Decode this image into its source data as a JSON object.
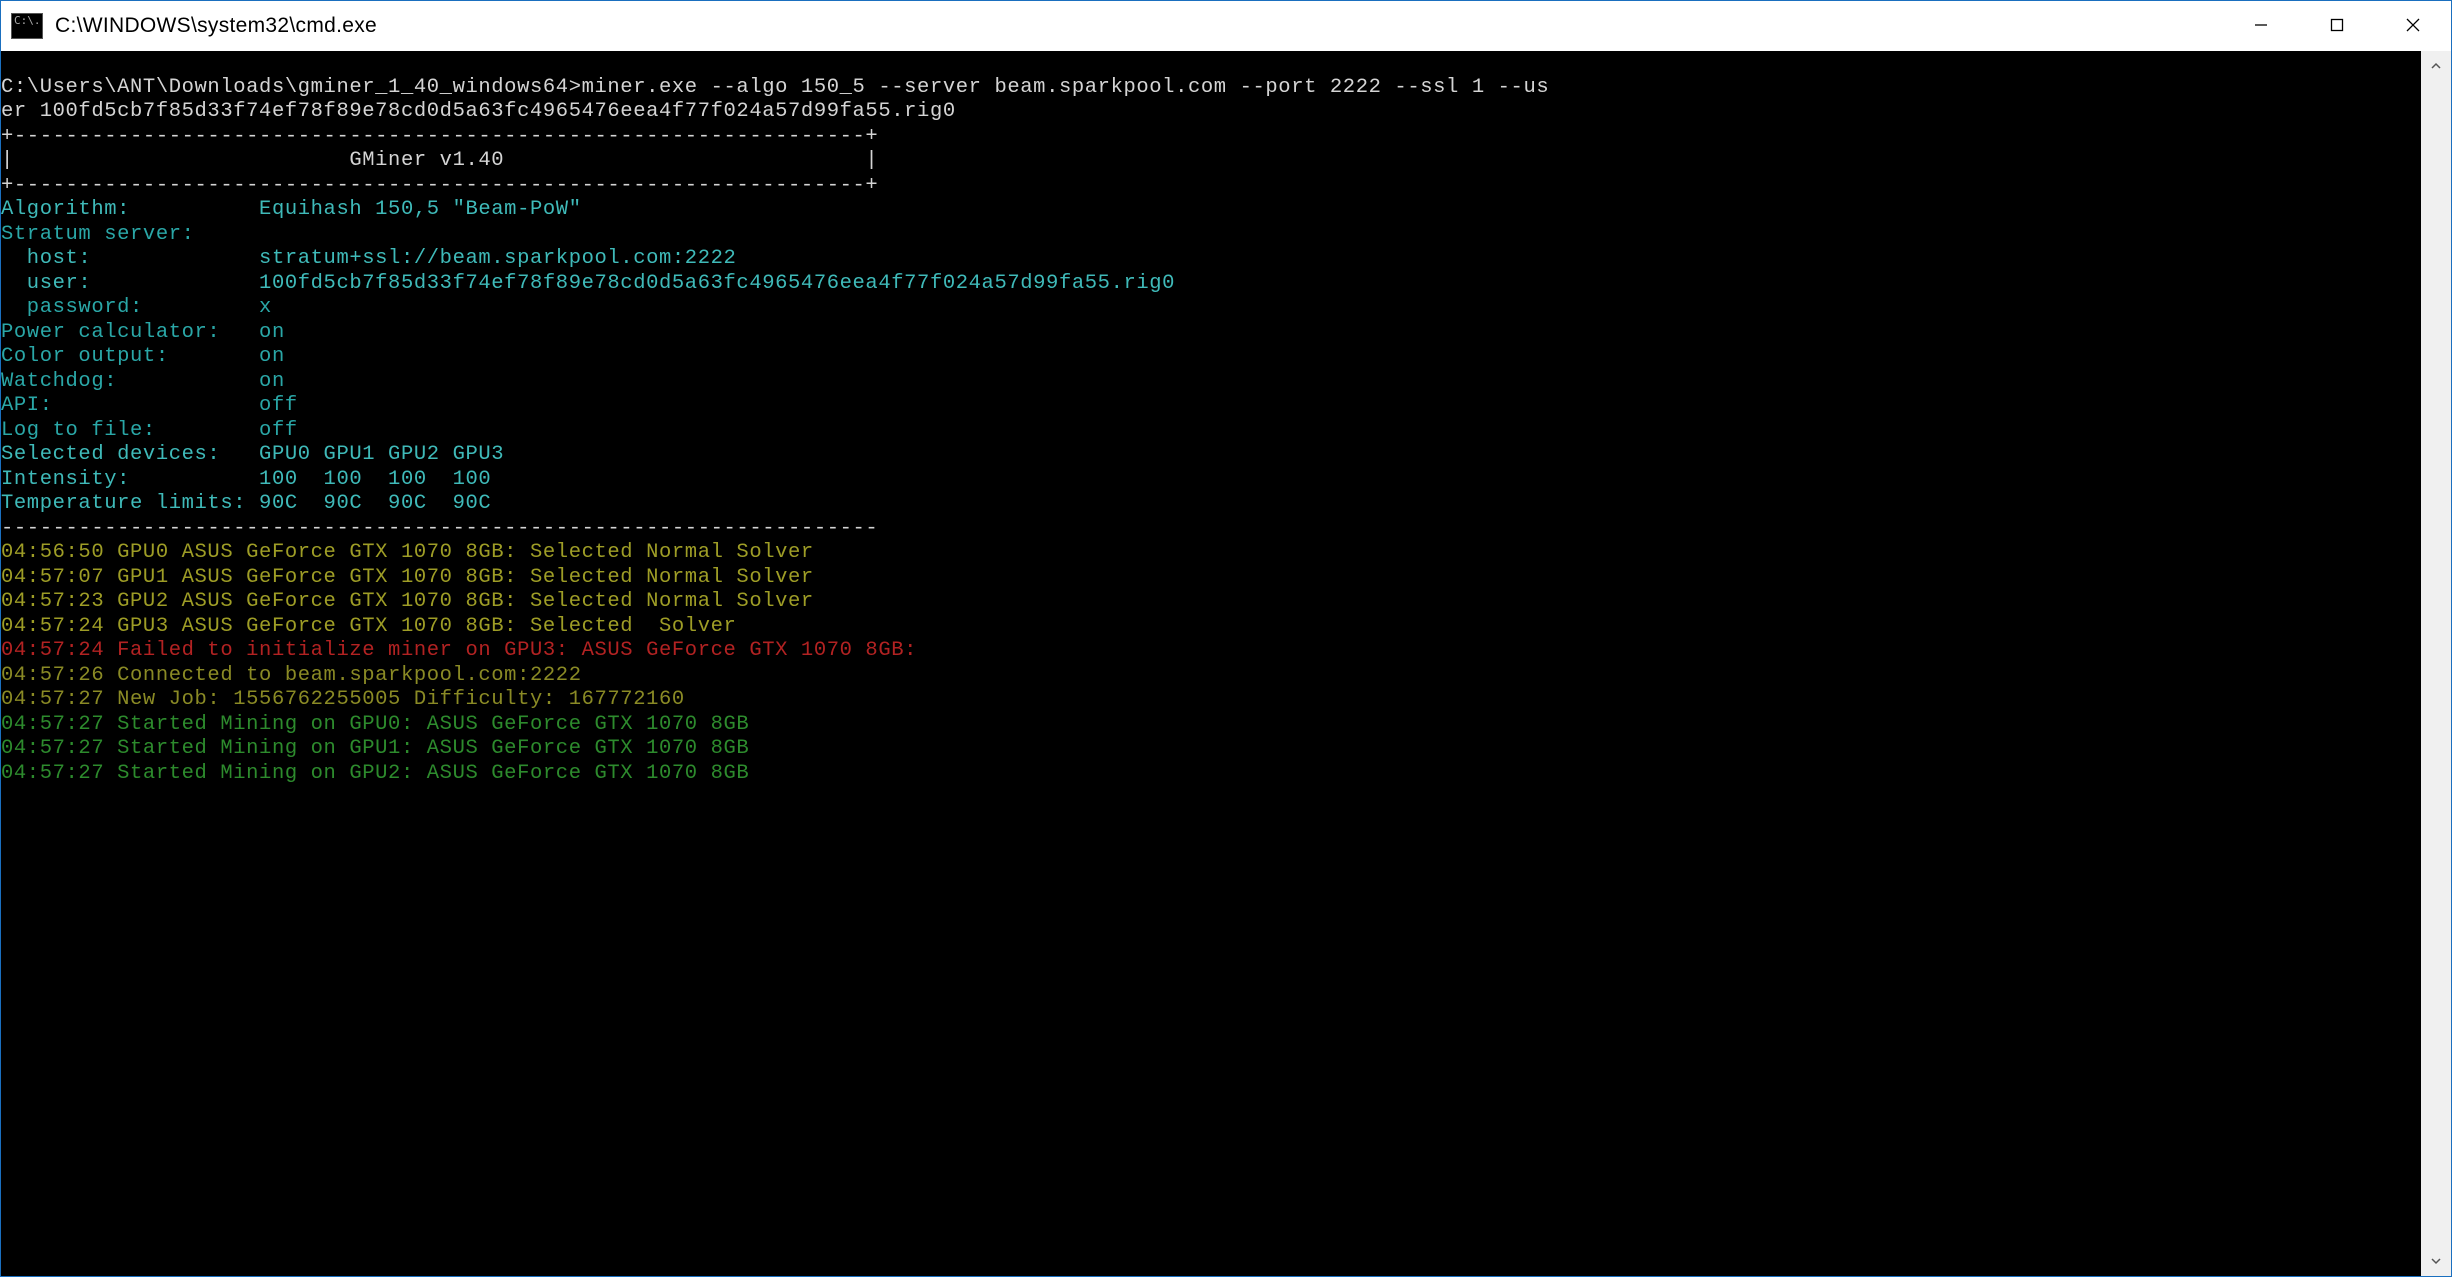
{
  "window": {
    "title": "C:\\WINDOWS\\system32\\cmd.exe",
    "icon_label": "C:\\."
  },
  "command": {
    "prompt": "C:\\Users\\ANT\\Downloads\\gminer_1_40_windows64>",
    "line1": "miner.exe --algo 150_5 --server beam.sparkpool.com --port 2222 --ssl 1 --us",
    "line2": "er 100fd5cb7f85d33f74ef78f89e78cd0d5a63fc4965476eea4f77f024a57d99fa55.rig0"
  },
  "header": {
    "border_top": "+------------------------------------------------------------------+",
    "title_row": "|                          GMiner v1.40                            |",
    "border_bot": "+------------------------------------------------------------------+"
  },
  "config": {
    "algorithm": "Algorithm:          Equihash 150,5 \"Beam-PoW\"",
    "stratum_header": "Stratum server:",
    "host": "  host:             stratum+ssl://beam.sparkpool.com:2222",
    "user": "  user:             100fd5cb7f85d33f74ef78f89e78cd0d5a63fc4965476eea4f77f024a57d99fa55.rig0",
    "password": "  password:         x",
    "power_calc": "Power calculator:   on",
    "color_output": "Color output:       on",
    "watchdog": "Watchdog:           on",
    "api": "API:                off",
    "log_to_file": "Log to file:        off",
    "selected_devices": "Selected devices:   GPU0 GPU1 GPU2 GPU3",
    "intensity": "Intensity:          100  100  100  100",
    "temp_limits": "Temperature limits: 90C  90C  90C  90C",
    "divider": "--------------------------------------------------------------------"
  },
  "log": {
    "l1": "04:56:50 GPU0 ASUS GeForce GTX 1070 8GB: Selected Normal Solver",
    "l2": "04:57:07 GPU1 ASUS GeForce GTX 1070 8GB: Selected Normal Solver",
    "l3": "04:57:23 GPU2 ASUS GeForce GTX 1070 8GB: Selected Normal Solver",
    "l4": "04:57:24 GPU3 ASUS GeForce GTX 1070 8GB: Selected  Solver",
    "l5": "04:57:24 Failed to initialize miner on GPU3: ASUS GeForce GTX 1070 8GB:",
    "l6": "04:57:26 Connected to beam.sparkpool.com:2222",
    "l7": "04:57:27 New Job: 1556762255005 Difficulty: 167772160",
    "l8": "04:57:27 Started Mining on GPU0: ASUS GeForce GTX 1070 8GB",
    "l9": "04:57:27 Started Mining on GPU1: ASUS GeForce GTX 1070 8GB",
    "l10": "04:57:27 Started Mining on GPU2: ASUS GeForce GTX 1070 8GB"
  }
}
